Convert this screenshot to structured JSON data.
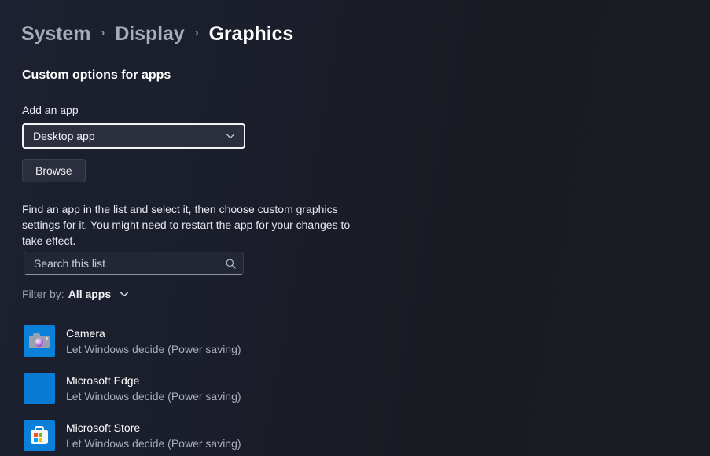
{
  "breadcrumb": {
    "items": [
      {
        "label": "System",
        "current": false
      },
      {
        "label": "Display",
        "current": false
      },
      {
        "label": "Graphics",
        "current": true
      }
    ],
    "separator": "›"
  },
  "section": {
    "heading": "Custom options for apps"
  },
  "add_app": {
    "label": "Add an app",
    "dropdown_value": "Desktop app",
    "dropdown_icon": "chevron-down-icon",
    "browse_label": "Browse"
  },
  "description": "Find an app in the list and select it, then choose custom graphics settings for it. You might need to restart the app for your changes to take effect.",
  "search": {
    "placeholder": "Search this list",
    "value": "",
    "icon": "search-icon"
  },
  "filter": {
    "label": "Filter by:",
    "value": "All apps",
    "icon": "chevron-down-icon"
  },
  "app_list": [
    {
      "name": "Camera",
      "status": "Let Windows decide (Power saving)",
      "icon": "camera-app-icon",
      "icon_color": "#0b80d8"
    },
    {
      "name": "Microsoft Edge",
      "status": "Let Windows decide (Power saving)",
      "icon": "microsoft-edge-app-icon",
      "icon_color": "#0b7ad4"
    },
    {
      "name": "Microsoft Store",
      "status": "Let Windows decide (Power saving)",
      "icon": "microsoft-store-app-icon",
      "icon_color": "#0b80d8"
    }
  ],
  "colors": {
    "background_left": "#1c2030",
    "background_right": "#1a1c24",
    "text_primary": "#ffffff",
    "text_secondary": "#a9aeba",
    "focus_ring": "#f2f3f6",
    "accent_blue": "#0b80d8"
  }
}
